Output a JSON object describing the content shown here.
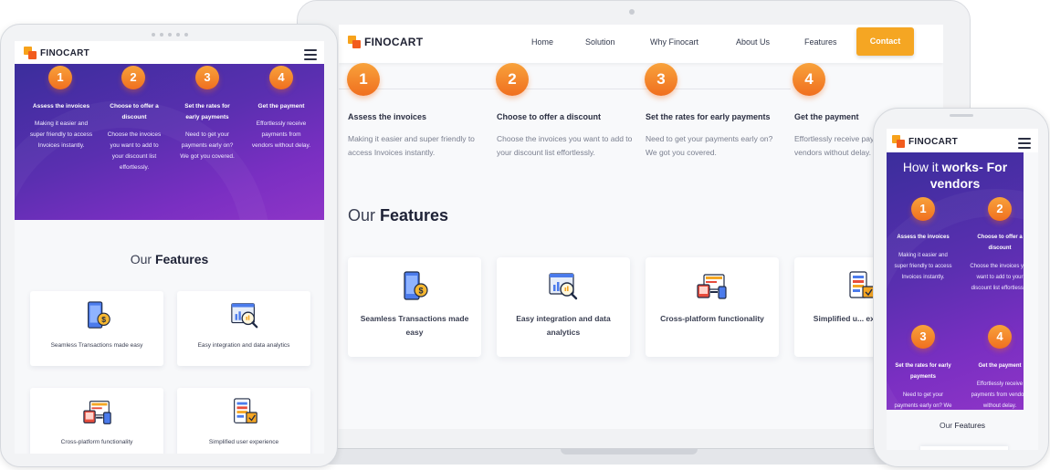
{
  "brand": {
    "name": "FINOCART",
    "accent": "#f5a623",
    "accent_dark": "#f06f1f",
    "purple": "#5a2fb0",
    "text_dark": "#1e2236"
  },
  "nav": {
    "items": [
      "Home",
      "Solution",
      "Why Finocart",
      "About Us",
      "Features"
    ],
    "contact_label": "Contact"
  },
  "how_it_works": {
    "title_prefix": "How it",
    "title_bold": "works- For vendors",
    "steps": [
      {
        "number": "1",
        "title": "Assess the invoices",
        "desc": "Making it easier and super friendly to access Invoices instantly."
      },
      {
        "number": "2",
        "title": "Choose to offer a discount",
        "desc": "Choose the invoices you want to add to your discount list effortlessly."
      },
      {
        "number": "3",
        "title": "Set the rates for early payments",
        "desc": "Need to get your payments early on? We got you covered."
      },
      {
        "number": "4",
        "title": "Get the payment",
        "desc": "Effortlessly receive payments from vendors without delay."
      }
    ],
    "tablet_descs": [
      "Making it easier and super friendly to access Invoices instantly.",
      "Choose the invoices you want to add to your discount list effortlessly.",
      "Need to get your payments early on? We got you covered.",
      "Effortlessly receive payments from vendors without delay."
    ]
  },
  "features": {
    "title_prefix": "Our",
    "title_bold": "Features",
    "items": [
      {
        "label": "Seamless Transactions made easy",
        "icon": "mobile-payment-icon"
      },
      {
        "label": "Easy integration and data analytics",
        "icon": "analytics-magnifier-icon"
      },
      {
        "label": "Cross-platform functionality",
        "icon": "devices-icon"
      },
      {
        "label": "Simplified user experience",
        "icon": "user-experience-icon"
      }
    ],
    "laptop_labels": [
      "Seamless Transactions made easy",
      "Easy integration and data analytics",
      "Cross-platform functionality",
      "Simplified u... experienc..."
    ]
  }
}
